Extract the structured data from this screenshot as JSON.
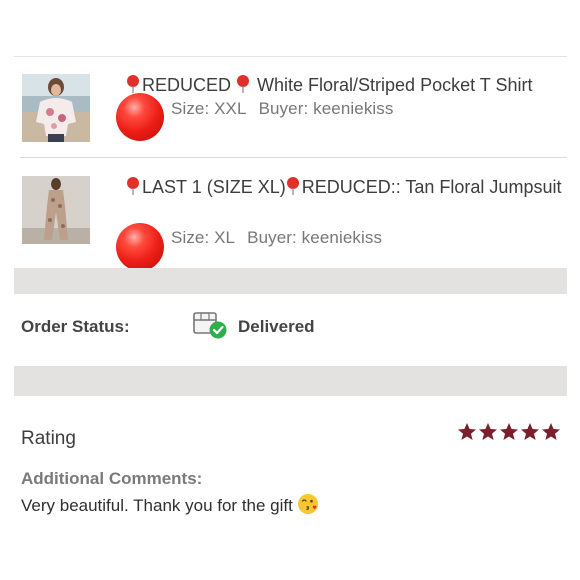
{
  "items": [
    {
      "title_parts": [
        "REDUCED ",
        " White Floral/Striped Pocket T Shirt"
      ],
      "size": "Size: XXL",
      "buyer": "Buyer: keeniekiss",
      "thumb_icon": "floral-shirt-photo",
      "badge_icon": "red-balloon-icon"
    },
    {
      "title_parts": [
        "LAST 1 (SIZE XL)",
        "REDUCED:: Tan Floral Jumpsuit"
      ],
      "size": "Size: XL",
      "buyer": "Buyer: keeniekiss",
      "thumb_icon": "floral-jumpsuit-photo",
      "badge_icon": "red-balloon-icon"
    }
  ],
  "order_status": {
    "label": "Order Status:",
    "value": "Delivered",
    "icon": "package-delivered-icon"
  },
  "rating": {
    "label": "Rating",
    "stars": 5,
    "max_stars": 5,
    "star_color": "#7b1f2a"
  },
  "comments": {
    "label": "Additional Comments:",
    "text": "Very beautiful. Thank you for the gift",
    "emoji_icon": "kiss-face-emoji"
  },
  "colors": {
    "balloon": "#ec1d15",
    "pin": "#e0302a",
    "check": "#2fae4e"
  }
}
